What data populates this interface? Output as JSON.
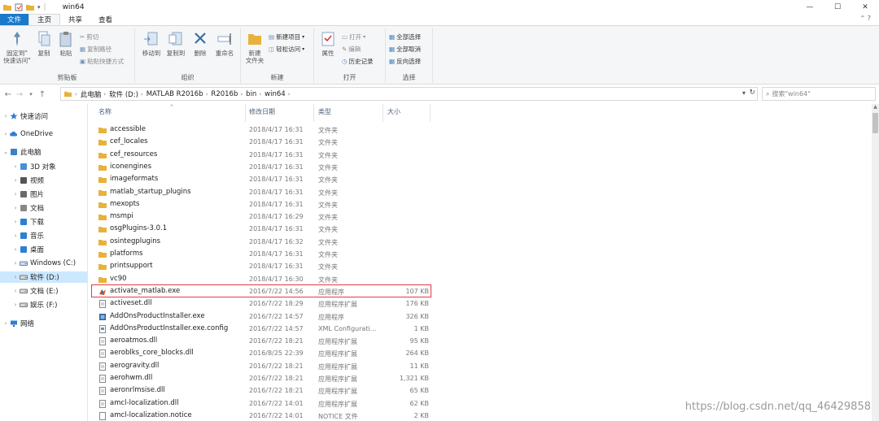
{
  "window": {
    "title": "win64",
    "controls": {
      "minimize": "—",
      "maximize": "☐",
      "close": "✕"
    }
  },
  "ribbon": {
    "tabs": [
      "文件",
      "主页",
      "共享",
      "查看"
    ],
    "groups": {
      "clipboard": {
        "label": "剪贴板",
        "pin": "固定到\"\n快速访问\"",
        "copy": "复制",
        "paste": "粘贴",
        "cut": "剪切",
        "copy_path": "复制路径",
        "paste_shortcut": "粘贴快捷方式"
      },
      "organize": {
        "label": "组织",
        "move_to": "移动到",
        "copy_to": "复制到",
        "delete": "删除",
        "rename": "重命名"
      },
      "new": {
        "label": "新建",
        "new_folder": "新建\n文件夹",
        "new_item": "新建项目",
        "easy_access": "轻松访问"
      },
      "open": {
        "label": "打开",
        "properties": "属性",
        "open": "打开",
        "edit": "编辑",
        "history": "历史记录"
      },
      "select": {
        "label": "选择",
        "select_all": "全部选择",
        "select_none": "全部取消",
        "invert": "反向选择"
      }
    }
  },
  "address": {
    "crumbs": [
      "此电脑",
      "软件 (D:)",
      "MATLAB R2016b",
      "R2016b",
      "bin",
      "win64"
    ],
    "search_placeholder": "搜索\"win64\""
  },
  "nav": [
    {
      "label": "快速访问",
      "level": 0,
      "icon": "star-icon",
      "color": "#2d7fd3"
    },
    {
      "label": "OneDrive",
      "level": 0,
      "icon": "cloud-icon",
      "color": "#2d7fd3"
    },
    {
      "label": "此电脑",
      "level": 0,
      "icon": "computer-icon",
      "color": "#3a82c4",
      "expanded": true
    },
    {
      "label": "3D 对象",
      "level": 1,
      "icon": "cube-icon",
      "color": "#4a8fd6"
    },
    {
      "label": "视频",
      "level": 1,
      "icon": "video-icon",
      "color": "#555"
    },
    {
      "label": "图片",
      "level": 1,
      "icon": "picture-icon",
      "color": "#6a6a6a"
    },
    {
      "label": "文档",
      "level": 1,
      "icon": "document-icon",
      "color": "#888"
    },
    {
      "label": "下载",
      "level": 1,
      "icon": "download-icon",
      "color": "#2d7fd3"
    },
    {
      "label": "音乐",
      "level": 1,
      "icon": "music-icon",
      "color": "#2d7fd3"
    },
    {
      "label": "桌面",
      "level": 1,
      "icon": "desktop-icon",
      "color": "#2d7fd3"
    },
    {
      "label": "Windows (C:)",
      "level": 1,
      "icon": "drive-icon",
      "color": "#4a8fd6"
    },
    {
      "label": "软件 (D:)",
      "level": 1,
      "icon": "drive-icon",
      "color": "#777",
      "selected": true
    },
    {
      "label": "文档 (E:)",
      "level": 1,
      "icon": "drive-icon",
      "color": "#777"
    },
    {
      "label": "娱乐 (F:)",
      "level": 1,
      "icon": "drive-icon",
      "color": "#777"
    },
    {
      "label": "网络",
      "level": 0,
      "icon": "network-icon",
      "color": "#2d7fd3"
    }
  ],
  "columns": {
    "name": "名称",
    "date": "修改日期",
    "type": "类型",
    "size": "大小"
  },
  "files": [
    {
      "name": "accessible",
      "date": "2018/4/17 16:31",
      "type": "文件夹",
      "size": "",
      "kind": "folder"
    },
    {
      "name": "cef_locales",
      "date": "2018/4/17 16:31",
      "type": "文件夹",
      "size": "",
      "kind": "folder"
    },
    {
      "name": "cef_resources",
      "date": "2018/4/17 16:31",
      "type": "文件夹",
      "size": "",
      "kind": "folder"
    },
    {
      "name": "iconengines",
      "date": "2018/4/17 16:31",
      "type": "文件夹",
      "size": "",
      "kind": "folder"
    },
    {
      "name": "imageformats",
      "date": "2018/4/17 16:31",
      "type": "文件夹",
      "size": "",
      "kind": "folder"
    },
    {
      "name": "matlab_startup_plugins",
      "date": "2018/4/17 16:31",
      "type": "文件夹",
      "size": "",
      "kind": "folder"
    },
    {
      "name": "mexopts",
      "date": "2018/4/17 16:31",
      "type": "文件夹",
      "size": "",
      "kind": "folder"
    },
    {
      "name": "msmpi",
      "date": "2018/4/17 16:29",
      "type": "文件夹",
      "size": "",
      "kind": "folder"
    },
    {
      "name": "osgPlugins-3.0.1",
      "date": "2018/4/17 16:31",
      "type": "文件夹",
      "size": "",
      "kind": "folder"
    },
    {
      "name": "osintegplugins",
      "date": "2018/4/17 16:32",
      "type": "文件夹",
      "size": "",
      "kind": "folder"
    },
    {
      "name": "platforms",
      "date": "2018/4/17 16:31",
      "type": "文件夹",
      "size": "",
      "kind": "folder"
    },
    {
      "name": "printsupport",
      "date": "2018/4/17 16:31",
      "type": "文件夹",
      "size": "",
      "kind": "folder"
    },
    {
      "name": "vc90",
      "date": "2018/4/17 16:30",
      "type": "文件夹",
      "size": "",
      "kind": "folder"
    },
    {
      "name": "activate_matlab.exe",
      "date": "2016/7/22 14:56",
      "type": "应用程序",
      "size": "107 KB",
      "kind": "exe",
      "highlighted": true
    },
    {
      "name": "activeset.dll",
      "date": "2016/7/22 18:29",
      "type": "应用程序扩展",
      "size": "176 KB",
      "kind": "dll"
    },
    {
      "name": "AddOnsProductInstaller.exe",
      "date": "2016/7/22 14:57",
      "type": "应用程序",
      "size": "326 KB",
      "kind": "exe2"
    },
    {
      "name": "AddOnsProductInstaller.exe.config",
      "date": "2016/7/22 14:57",
      "type": "XML Configurati...",
      "size": "1 KB",
      "kind": "config"
    },
    {
      "name": "aeroatmos.dll",
      "date": "2016/7/22 18:21",
      "type": "应用程序扩展",
      "size": "95 KB",
      "kind": "dll"
    },
    {
      "name": "aeroblks_core_blocks.dll",
      "date": "2016/8/25 22:39",
      "type": "应用程序扩展",
      "size": "264 KB",
      "kind": "dll"
    },
    {
      "name": "aerogravity.dll",
      "date": "2016/7/22 18:21",
      "type": "应用程序扩展",
      "size": "11 KB",
      "kind": "dll"
    },
    {
      "name": "aerohwm.dll",
      "date": "2016/7/22 18:21",
      "type": "应用程序扩展",
      "size": "1,321 KB",
      "kind": "dll"
    },
    {
      "name": "aeronrlmsise.dll",
      "date": "2016/7/22 18:21",
      "type": "应用程序扩展",
      "size": "65 KB",
      "kind": "dll"
    },
    {
      "name": "amcl-localization.dll",
      "date": "2016/7/22 14:01",
      "type": "应用程序扩展",
      "size": "62 KB",
      "kind": "dll"
    },
    {
      "name": "amcl-localization.notice",
      "date": "2016/7/22 14:01",
      "type": "NOTICE 文件",
      "size": "2 KB",
      "kind": "file"
    }
  ],
  "watermark": "https://blog.csdn.net/qq_46429858",
  "colors": {
    "accent": "#1979ca",
    "folder": "#e8b23a",
    "highlight": "#e23a3a",
    "selected": "#cce8ff"
  }
}
